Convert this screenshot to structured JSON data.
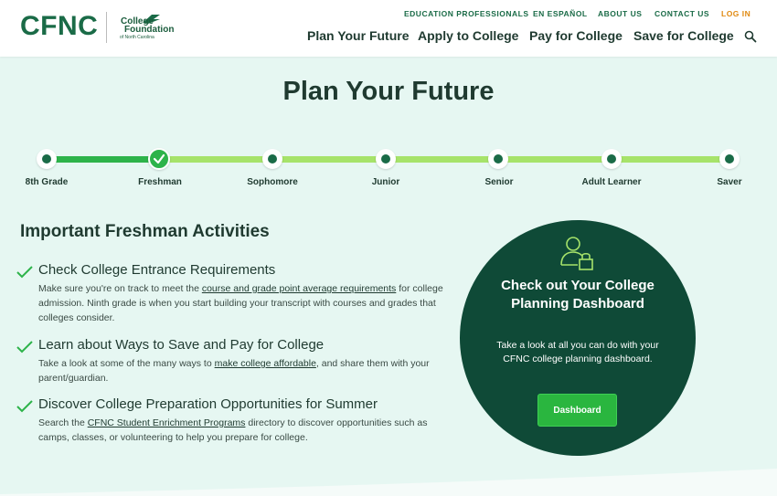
{
  "header": {
    "logo_main": "CFNC",
    "logo_sub_line1": "College",
    "logo_sub_line2": "Foundation",
    "logo_sub_line3": "of North Carolina",
    "utility": [
      "EDUCATION PROFESSIONALS",
      "EN ESPAÑOL",
      "ABOUT US",
      "CONTACT US",
      "LOG IN"
    ],
    "nav": [
      "Plan Your Future",
      "Apply to College",
      "Pay for College",
      "Save for College"
    ]
  },
  "page_title": "Plan Your Future",
  "timeline": {
    "stages": [
      "8th Grade",
      "Freshman",
      "Sophomore",
      "Junior",
      "Senior",
      "Adult Learner",
      "Saver"
    ],
    "current": "Freshman"
  },
  "activities": {
    "heading": "Important Freshman Activities",
    "items": [
      {
        "title": "Check College Entrance Requirements",
        "text_before": "Make sure you're on track to meet the ",
        "link": "course and grade point average requirements",
        "text_after": " for college admission.  Ninth grade is when you start building your transcript with courses and grades that colleges consider."
      },
      {
        "title": "Learn about Ways to Save and Pay for College",
        "text_before": "Take a look at some of the many ways to ",
        "link": "make college affordable",
        "text_after": ", and share them with your parent/guardian."
      },
      {
        "title": "Discover College Preparation Opportunities for Summer",
        "text_before": "Search the ",
        "link": "CFNC Student Enrichment Programs",
        "text_after": " directory to discover opportunities such as camps, classes, or volunteering to help you prepare for college."
      }
    ]
  },
  "dashboard_card": {
    "title": "Check out Your College Planning Dashboard",
    "text": "Take a look at all you can do with your CFNC college planning dashboard.",
    "button": "Dashboard"
  },
  "colors": {
    "brand_green": "#1a6b47",
    "accent_orange": "#e08a12",
    "progress_dark": "#2db34a",
    "progress_light": "#a6e36a",
    "card_bg": "#0f4a37",
    "page_bg": "#e6f7f2"
  }
}
